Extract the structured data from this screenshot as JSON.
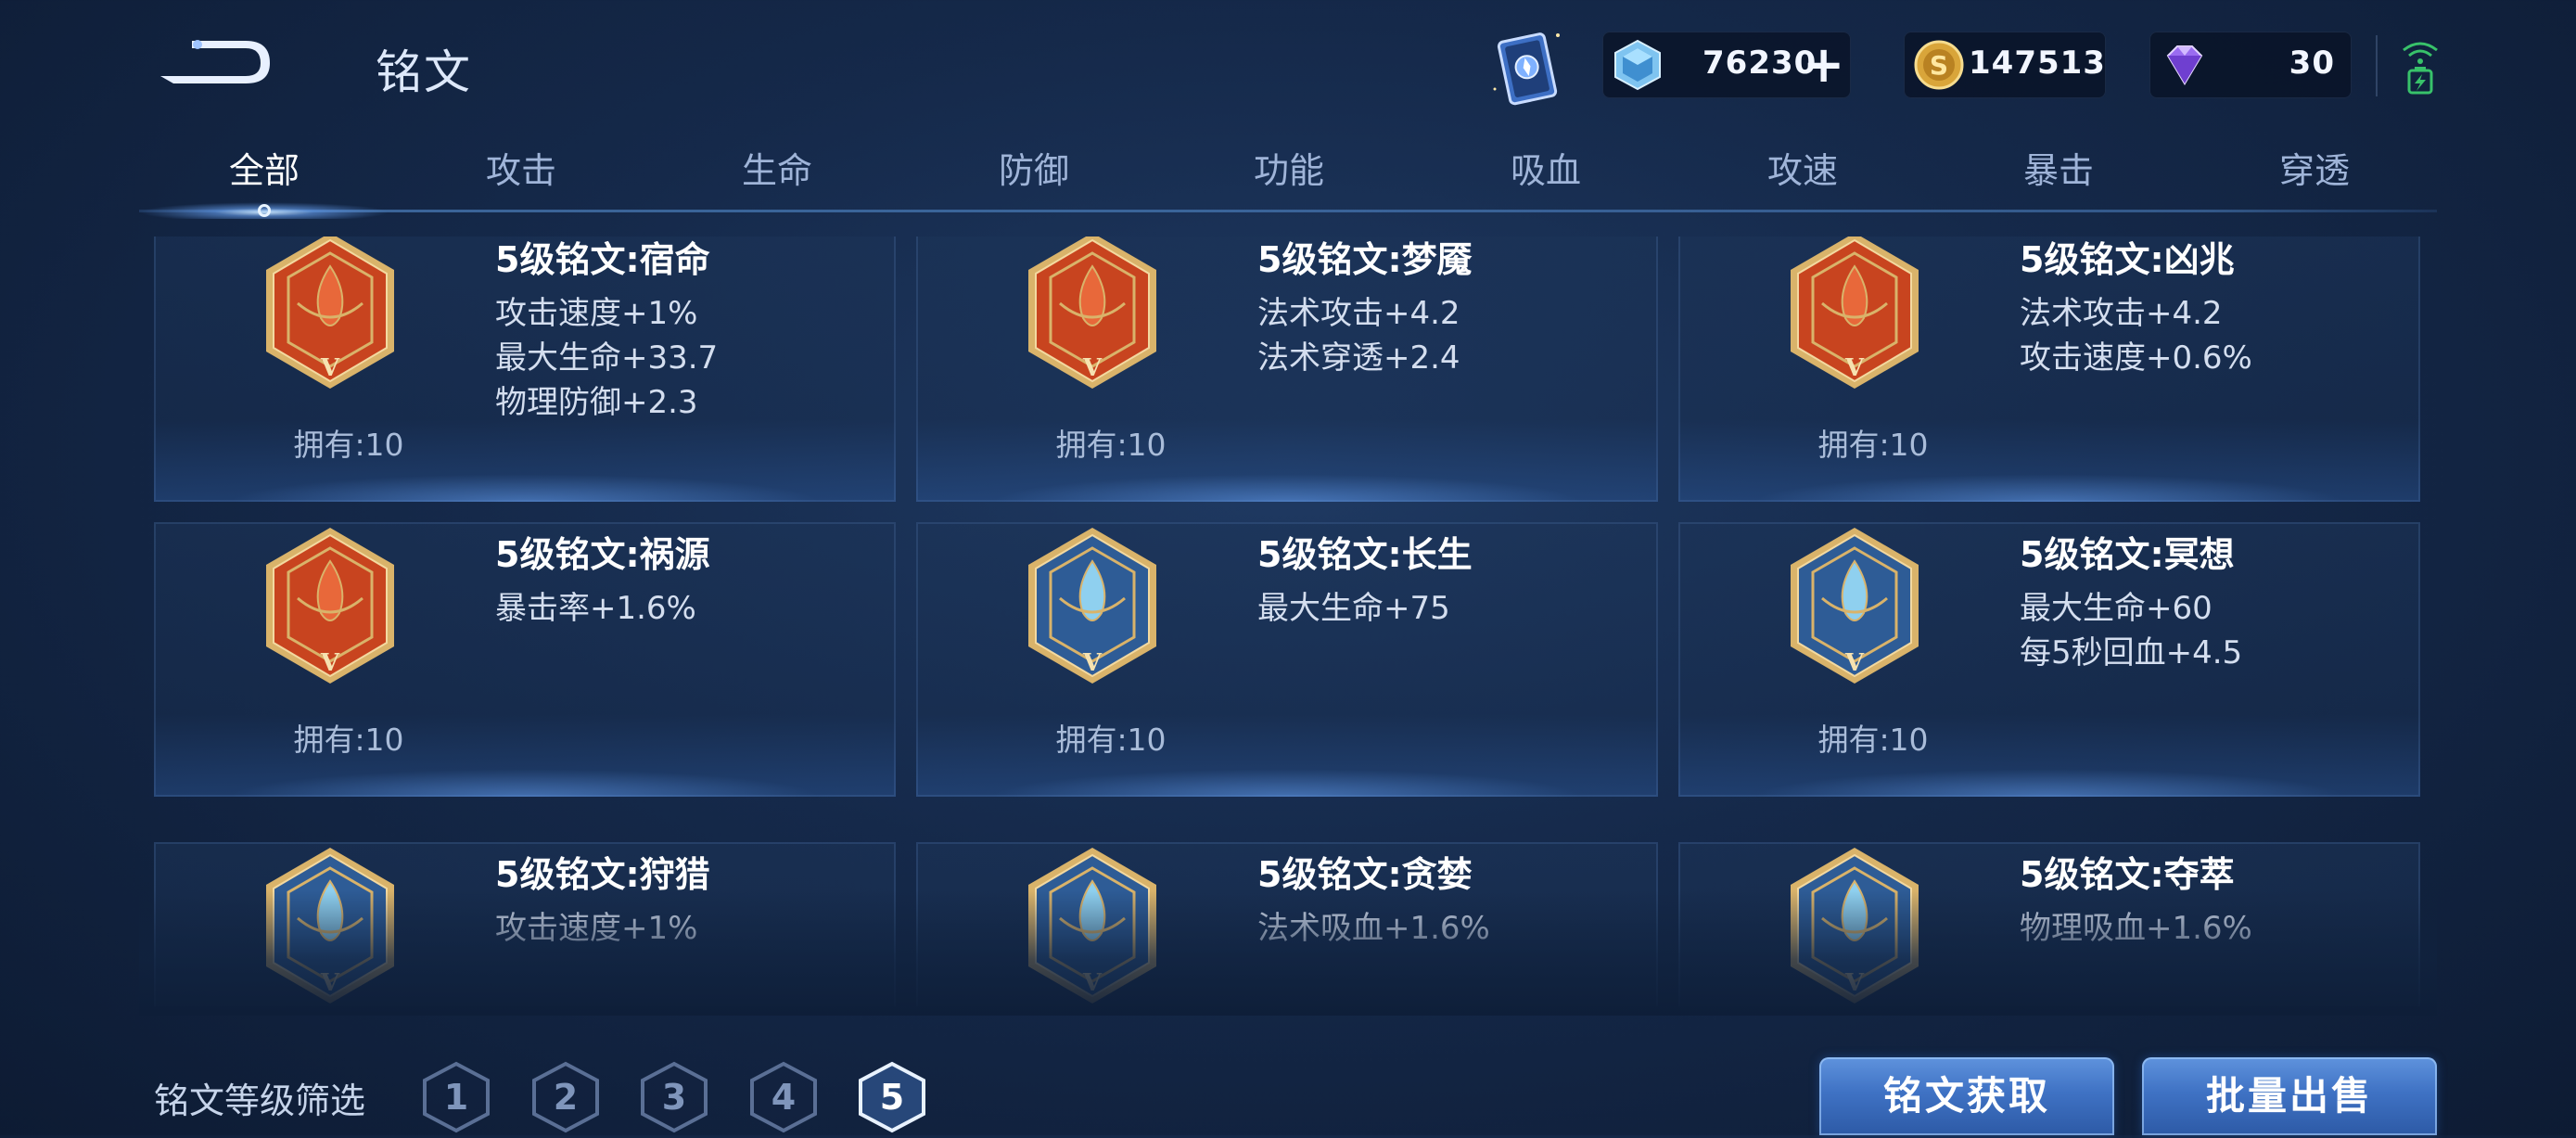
{
  "header": {
    "title": "铭文",
    "resources": {
      "crystal": "76230",
      "gold": "147513",
      "diamond": "30"
    }
  },
  "tabs": [
    {
      "label": "全部"
    },
    {
      "label": "攻击"
    },
    {
      "label": "生命"
    },
    {
      "label": "防御"
    },
    {
      "label": "功能"
    },
    {
      "label": "吸血"
    },
    {
      "label": "攻速"
    },
    {
      "label": "暴击"
    },
    {
      "label": "穿透"
    }
  ],
  "active_tab": "全部",
  "inscriptions": [
    {
      "name": "5级铭文:宿命",
      "stats": [
        "攻击速度+1%",
        "最大生命+33.7",
        "物理防御+2.3"
      ],
      "owned": "拥有:10",
      "color": "red"
    },
    {
      "name": "5级铭文:梦魇",
      "stats": [
        "法术攻击+4.2",
        "法术穿透+2.4"
      ],
      "owned": "拥有:10",
      "color": "red"
    },
    {
      "name": "5级铭文:凶兆",
      "stats": [
        "法术攻击+4.2",
        "攻击速度+0.6%"
      ],
      "owned": "拥有:10",
      "color": "red"
    },
    {
      "name": "5级铭文:祸源",
      "stats": [
        "暴击率+1.6%"
      ],
      "owned": "拥有:10",
      "color": "red"
    },
    {
      "name": "5级铭文:长生",
      "stats": [
        "最大生命+75"
      ],
      "owned": "拥有:10",
      "color": "blue"
    },
    {
      "name": "5级铭文:冥想",
      "stats": [
        "最大生命+60",
        "每5秒回血+4.5"
      ],
      "owned": "拥有:10",
      "color": "blue"
    },
    {
      "name": "5级铭文:狩猎",
      "stats": [
        "攻击速度+1%"
      ],
      "owned": "",
      "color": "blue"
    },
    {
      "name": "5级铭文:贪婪",
      "stats": [
        "法术吸血+1.6%"
      ],
      "owned": "",
      "color": "blue"
    },
    {
      "name": "5级铭文:夺萃",
      "stats": [
        "物理吸血+1.6%"
      ],
      "owned": "",
      "color": "blue"
    }
  ],
  "filter": {
    "label": "铭文等级筛选",
    "levels": [
      "1",
      "2",
      "3",
      "4",
      "5"
    ],
    "selected": "5"
  },
  "buttons": {
    "acquire": "铭文获取",
    "bulk_sell": "批量出售"
  },
  "colors": {
    "background": "#15294a",
    "button": "#3f72c4",
    "emblem_red": "#c8441f",
    "emblem_blue": "#2e5c96",
    "emblem_gold": "#d9b36a"
  }
}
